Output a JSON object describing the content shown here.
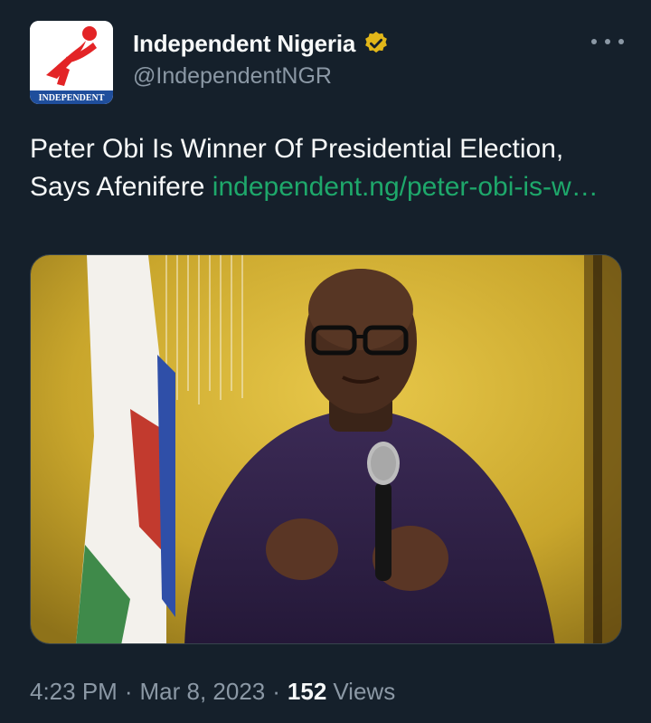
{
  "account": {
    "display_name": "Independent Nigeria",
    "handle": "@IndependentNGR",
    "avatar_text": "INDEPENDENT"
  },
  "tweet": {
    "text": "Peter Obi Is Winner Of Presidential Election, Says Afenifere ",
    "link_text": "independent.ng/peter-obi-is-w…",
    "time": "4:23 PM",
    "separator": "·",
    "date": "Mar 8, 2023",
    "views_count": "152",
    "views_label": "Views"
  },
  "colors": {
    "background": "#15202b",
    "link": "#1ea86b",
    "verified_badge": "#e2b719",
    "secondary_text": "#8b98a5"
  },
  "icons": {
    "verified": "verified-badge-icon",
    "more": "more-options-icon"
  }
}
